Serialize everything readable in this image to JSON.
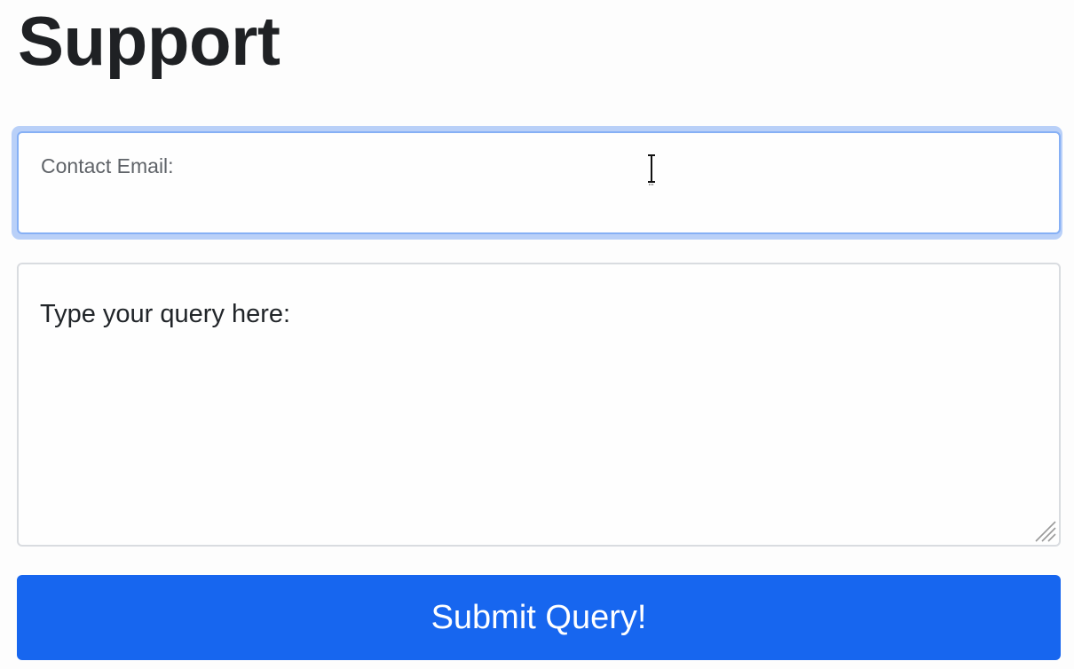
{
  "header": {
    "title": "Support"
  },
  "form": {
    "email": {
      "label": "Contact Email:",
      "value": ""
    },
    "query": {
      "placeholder": "Type your query here:",
      "value": ""
    },
    "submit_label": "Submit Query!"
  },
  "colors": {
    "accent": "#1766ef",
    "focus_ring": "#b9d0f8",
    "focus_border": "#86b0f5"
  },
  "icons": {
    "cursor": "text-cursor-icon",
    "resize": "resize-handle-icon"
  }
}
